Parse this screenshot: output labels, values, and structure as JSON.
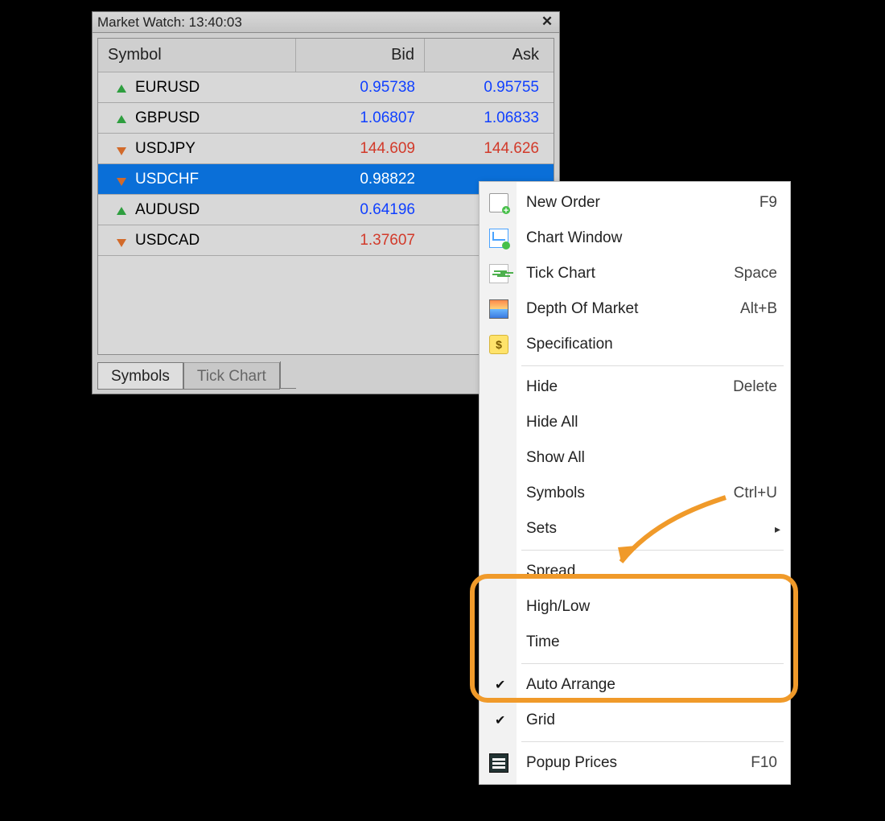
{
  "window": {
    "title": "Market Watch: 13:40:03"
  },
  "columns": {
    "symbol": "Symbol",
    "bid": "Bid",
    "ask": "Ask"
  },
  "rows": [
    {
      "dir": "up",
      "symbol": "EURUSD",
      "bid": "0.95738",
      "ask": "0.95755"
    },
    {
      "dir": "up",
      "symbol": "GBPUSD",
      "bid": "1.06807",
      "ask": "1.06833"
    },
    {
      "dir": "down",
      "symbol": "USDJPY",
      "bid": "144.609",
      "ask": "144.626"
    },
    {
      "dir": "down",
      "symbol": "USDCHF",
      "bid": "0.98822",
      "ask": "",
      "selected": true
    },
    {
      "dir": "up",
      "symbol": "AUDUSD",
      "bid": "0.64196",
      "ask": ""
    },
    {
      "dir": "down",
      "symbol": "USDCAD",
      "bid": "1.37607",
      "ask": ""
    }
  ],
  "tabs": {
    "symbols": "Symbols",
    "tick": "Tick Chart"
  },
  "menu": {
    "new_order": {
      "label": "New Order",
      "accel": "F9"
    },
    "chart_window": {
      "label": "Chart Window",
      "accel": ""
    },
    "tick_chart": {
      "label": "Tick Chart",
      "accel": "Space"
    },
    "depth": {
      "label": "Depth Of Market",
      "accel": "Alt+B"
    },
    "spec": {
      "label": "Specification",
      "accel": ""
    },
    "hide": {
      "label": "Hide",
      "accel": "Delete"
    },
    "hide_all": {
      "label": "Hide All",
      "accel": ""
    },
    "show_all": {
      "label": "Show All",
      "accel": ""
    },
    "symbols": {
      "label": "Symbols",
      "accel": "Ctrl+U"
    },
    "sets": {
      "label": "Sets",
      "accel": ""
    },
    "spread": {
      "label": "Spread",
      "accel": ""
    },
    "high_low": {
      "label": "High/Low",
      "accel": ""
    },
    "time": {
      "label": "Time",
      "accel": ""
    },
    "auto_arrange": {
      "label": "Auto Arrange",
      "accel": ""
    },
    "grid": {
      "label": "Grid",
      "accel": ""
    },
    "popup": {
      "label": "Popup Prices",
      "accel": "F10"
    }
  }
}
